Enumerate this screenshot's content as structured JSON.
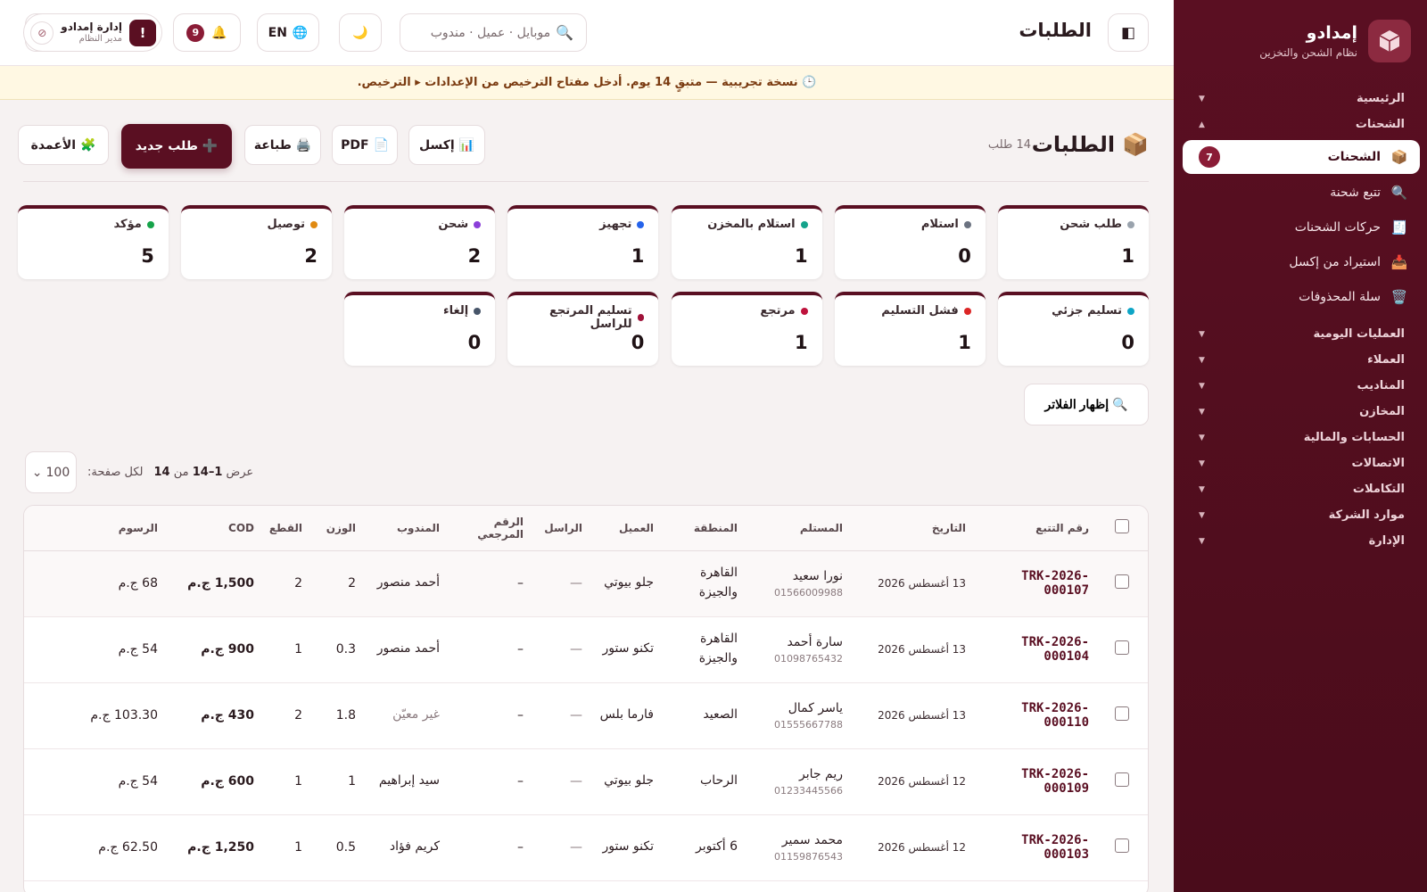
{
  "brand": {
    "name": "إمدادو",
    "subtitle": "نظام الشحن والتخزين"
  },
  "sidebar": {
    "groups_top": [
      {
        "label": "الرئيسية",
        "arrow": "▼"
      },
      {
        "label": "الشحنات",
        "arrow": "▲"
      }
    ],
    "sub_items": [
      {
        "label": "الشحنات",
        "icon": "📦",
        "badge": "7",
        "active": true
      },
      {
        "label": "تتبع شحنة",
        "icon": "🔍"
      },
      {
        "label": "حركات الشحنات",
        "icon": "🧾"
      },
      {
        "label": "استيراد من إكسل",
        "icon": "📥"
      },
      {
        "label": "سلة المحذوفات",
        "icon": "🗑️"
      }
    ],
    "groups_bottom": [
      {
        "label": "العمليات اليومية",
        "arrow": "▼"
      },
      {
        "label": "العملاء",
        "arrow": "▼"
      },
      {
        "label": "المناديب",
        "arrow": "▼"
      },
      {
        "label": "المخازن",
        "arrow": "▼"
      },
      {
        "label": "الحسابات والمالية",
        "arrow": "▼"
      },
      {
        "label": "الاتصالات",
        "arrow": "▼"
      },
      {
        "label": "التكاملات",
        "arrow": "▼"
      },
      {
        "label": "موارد الشركة",
        "arrow": "▼"
      },
      {
        "label": "الإدارة",
        "arrow": "▼"
      }
    ]
  },
  "topbar": {
    "title": "الطلبات",
    "sidebar_toggle_icon": "◧",
    "search_placeholder": "موبايل · عميل · مندوب",
    "search_icon": "🔍",
    "theme_icon": "🌙",
    "lang_icon": "🌐",
    "lang_label": "EN",
    "bell_icon": "🔔",
    "notif_count": "9",
    "user": {
      "name": "إدارة إمدادو",
      "role": "مدير النظام",
      "alert": "!",
      "logout_icon": "⦸"
    }
  },
  "trial_banner": "🕒 نسخة تجريبية — متبقٍ 14 يوم. أدخل مفتاح الترخيص من الإعدادات ▸ الترخيص.",
  "section": {
    "icon": "📦",
    "title": "الطلبات",
    "count": "14 طلب",
    "buttons": {
      "excel": "📊 إكسل",
      "pdf": "📄 PDF",
      "print": "🖨️ طباعة",
      "new_order": "➕ طلب جديد",
      "columns": "🧩 الأعمدة"
    }
  },
  "status_cards": [
    {
      "label": "طلب شحن",
      "value": "1",
      "color": "#9aa3ad"
    },
    {
      "label": "استلام",
      "value": "0",
      "color": "#6b7280"
    },
    {
      "label": "استلام بالمخزن",
      "value": "1",
      "color": "#14a38b"
    },
    {
      "label": "تجهيز",
      "value": "1",
      "color": "#2563eb"
    },
    {
      "label": "شحن",
      "value": "2",
      "color": "#8b3fd9"
    },
    {
      "label": "توصيل",
      "value": "2",
      "color": "#e08a12"
    },
    {
      "label": "مؤكد",
      "value": "5",
      "color": "#16a34a"
    },
    {
      "label": "تسليم جزئي",
      "value": "0",
      "color": "#0ea5c6"
    },
    {
      "label": "فشل التسليم",
      "value": "1",
      "color": "#dc2626"
    },
    {
      "label": "مرتجع",
      "value": "1",
      "color": "#be123c"
    },
    {
      "label": "تسليم المرتجع للراسل",
      "value": "0",
      "color": "#9f1239"
    },
    {
      "label": "إلغاء",
      "value": "0",
      "color": "#475569"
    }
  ],
  "filters": {
    "label": "🔍 إظهار الفلاتر"
  },
  "pagination": {
    "prefix": "عرض",
    "range": "1–14",
    "of": "من",
    "total": "14",
    "per_page_label": "لكل صفحة:",
    "per_page_value": "100",
    "chevron": "⌄"
  },
  "table": {
    "headers": [
      "",
      "رقم التتبع",
      "التاريخ",
      "المستلم",
      "المنطقة",
      "العميل",
      "الراسل",
      "الرقم المرجعي",
      "المندوب",
      "الوزن",
      "القطع",
      "COD",
      "الرسوم"
    ],
    "rows": [
      {
        "tracking": "TRK-2026-000107",
        "date": "13 أغسطس 2026",
        "recipient": "نورا سعيد",
        "phone": "01566009988",
        "region": "القاهرة والجيزة",
        "client": "جلو بيوتي",
        "sender": "—",
        "ref": "–",
        "courier": "أحمد منصور",
        "courier_muted": false,
        "weight": "2",
        "pieces": "2",
        "cod": "1,500 ج.م",
        "fees": "68 ج.م"
      },
      {
        "tracking": "TRK-2026-000104",
        "date": "13 أغسطس 2026",
        "recipient": "سارة أحمد",
        "phone": "01098765432",
        "region": "القاهرة والجيزة",
        "client": "تكنو ستور",
        "sender": "—",
        "ref": "–",
        "courier": "أحمد منصور",
        "courier_muted": false,
        "weight": "0.3",
        "pieces": "1",
        "cod": "900 ج.م",
        "fees": "54 ج.م"
      },
      {
        "tracking": "TRK-2026-000110",
        "date": "13 أغسطس 2026",
        "recipient": "ياسر كمال",
        "phone": "01555667788",
        "region": "الصعيد",
        "client": "فارما بلس",
        "sender": "—",
        "ref": "–",
        "courier": "غير معيّن",
        "courier_muted": true,
        "weight": "1.8",
        "pieces": "2",
        "cod": "430 ج.م",
        "fees": "103.30 ج.م"
      },
      {
        "tracking": "TRK-2026-000109",
        "date": "12 أغسطس 2026",
        "recipient": "ريم جابر",
        "phone": "01233445566",
        "region": "الرحاب",
        "client": "جلو بيوتي",
        "sender": "—",
        "ref": "–",
        "courier": "سيد إبراهيم",
        "courier_muted": false,
        "weight": "1",
        "pieces": "1",
        "cod": "600 ج.م",
        "fees": "54 ج.م"
      },
      {
        "tracking": "TRK-2026-000103",
        "date": "12 أغسطس 2026",
        "recipient": "محمد سمير",
        "phone": "01159876543",
        "region": "6 أكتوبر",
        "client": "تكنو ستور",
        "sender": "—",
        "ref": "–",
        "courier": "كريم فؤاد",
        "courier_muted": false,
        "weight": "0.5",
        "pieces": "1",
        "cod": "1,250 ج.م",
        "fees": "62.50 ج.م"
      }
    ]
  }
}
